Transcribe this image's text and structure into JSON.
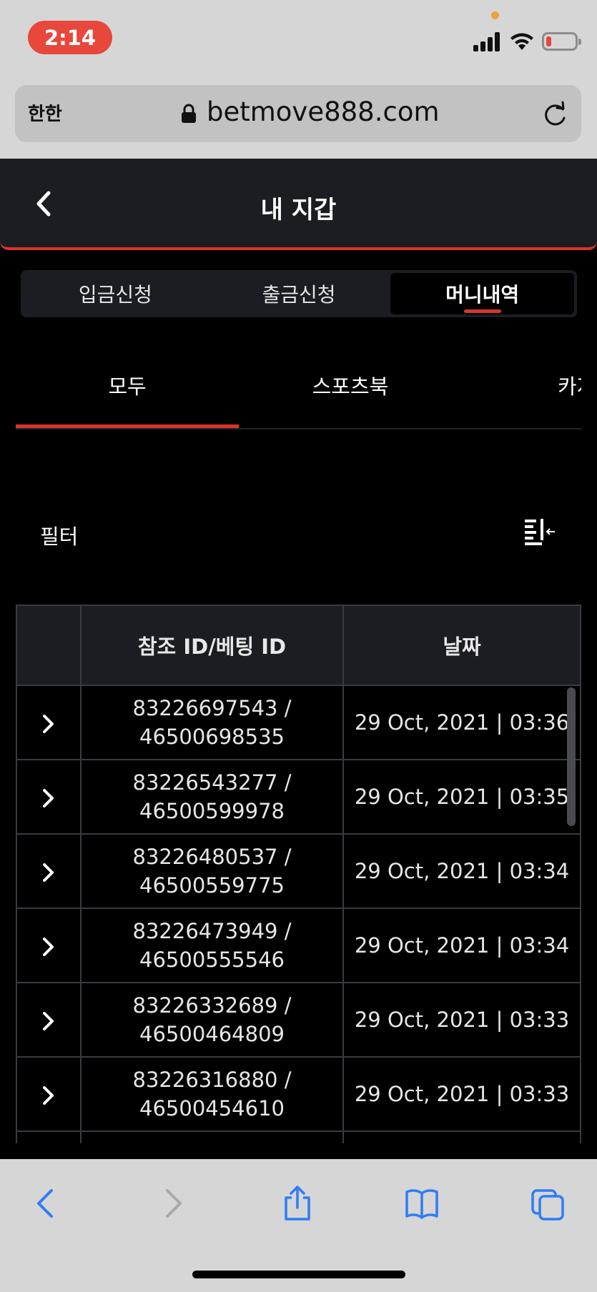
{
  "status_bar": {
    "time": "2:14"
  },
  "browser": {
    "text_size_label": "한한",
    "url": "betmove888.com"
  },
  "header": {
    "title": "내 지갑"
  },
  "segments": [
    {
      "label": "입금신청",
      "active": false
    },
    {
      "label": "출금신청",
      "active": false
    },
    {
      "label": "머니내역",
      "active": true
    }
  ],
  "categories": [
    {
      "label": "모두",
      "active": true
    },
    {
      "label": "스포츠북",
      "active": false
    },
    {
      "label": "카지"
    }
  ],
  "filter": {
    "label": "필터"
  },
  "table": {
    "headers": [
      "",
      "참조 ID/베팅 ID",
      "날짜"
    ],
    "rows": [
      {
        "ref_id": "83226697543 /",
        "bet_id": "46500698535",
        "date": "29 Oct, 2021 | 03:36"
      },
      {
        "ref_id": "83226543277 /",
        "bet_id": "46500599978",
        "date": "29 Oct, 2021 | 03:35"
      },
      {
        "ref_id": "83226480537 /",
        "bet_id": "46500559775",
        "date": "29 Oct, 2021 | 03:34"
      },
      {
        "ref_id": "83226473949 /",
        "bet_id": "46500555546",
        "date": "29 Oct, 2021 | 03:34"
      },
      {
        "ref_id": "83226332689 /",
        "bet_id": "46500464809",
        "date": "29 Oct, 2021 | 03:33"
      },
      {
        "ref_id": "83226316880 /",
        "bet_id": "46500454610",
        "date": "29 Oct, 2021 | 03:33"
      }
    ]
  },
  "colors": {
    "accent": "#d8362b",
    "header_bg": "#1c1d22",
    "page_bg": "#000000",
    "ios_blue": "#2f7cf6"
  },
  "icons": [
    "lock-icon",
    "reload-icon",
    "back-chevron-icon",
    "filter-icon",
    "chevron-right-icon",
    "safari-back-icon",
    "safari-forward-icon",
    "share-icon",
    "bookmarks-icon",
    "tabs-icon"
  ]
}
